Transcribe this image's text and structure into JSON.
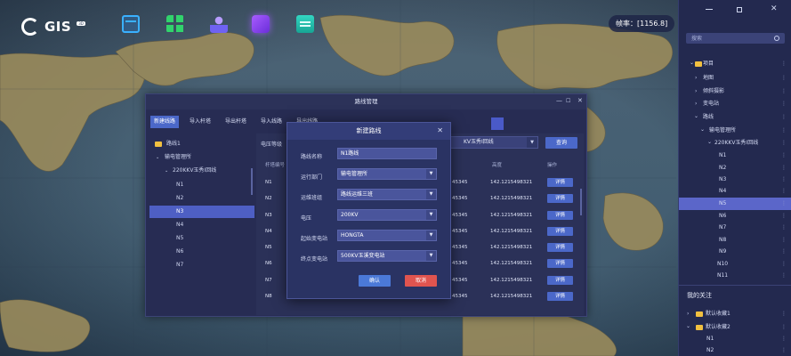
{
  "app": {
    "logo_text": "GIS",
    "logo_badge": "3D",
    "fps_label": "帧率：[1156.8]"
  },
  "toolbar": {
    "icons": [
      "layers-icon",
      "grid-apps-icon",
      "user-location-icon",
      "cube-3d-icon",
      "list-panel-icon"
    ]
  },
  "right_panel": {
    "search_placeholder": "搜索",
    "tree": [
      {
        "label": "项目"
      },
      {
        "label": "地图"
      },
      {
        "label": "倾斜摄影"
      },
      {
        "label": "变电站"
      },
      {
        "label": "路线"
      },
      {
        "label": "输电管理所"
      },
      {
        "label": "220KKV玉秀Ⅰ回线"
      },
      {
        "label": "N1"
      },
      {
        "label": "N2"
      },
      {
        "label": "N3"
      },
      {
        "label": "N4"
      },
      {
        "label": "N5"
      },
      {
        "label": "N6"
      },
      {
        "label": "N7"
      },
      {
        "label": "N8"
      },
      {
        "label": "N9"
      },
      {
        "label": "N10"
      },
      {
        "label": "N11"
      }
    ],
    "favorites_title": "我的关注",
    "favorites": [
      {
        "label": "默认收藏1"
      },
      {
        "label": "默认收藏2"
      },
      {
        "label": "N1"
      },
      {
        "label": "N2"
      }
    ]
  },
  "route_dialog": {
    "title": "路线管理",
    "tabs": [
      "新建线路",
      "导入杆塔",
      "导出杆塔",
      "导入线路",
      "导出线路"
    ],
    "left_tree": [
      {
        "label": "路线1"
      },
      {
        "label": "输电管理所"
      },
      {
        "label": "220KKV玉秀Ⅰ回线"
      },
      {
        "label": "N1"
      },
      {
        "label": "N2"
      },
      {
        "label": "N3"
      },
      {
        "label": "N4"
      },
      {
        "label": "N5"
      },
      {
        "label": "N6"
      },
      {
        "label": "N7"
      }
    ],
    "filter_label": "电压等级",
    "line_select_value": "KV玉秀Ⅰ回线",
    "query_label": "查询",
    "columns": {
      "tower_no": "杆塔编号",
      "height": "高度",
      "action": "操作"
    },
    "rows": [
      {
        "tower": "N1",
        "lng": "45345",
        "height": "142.1215498321",
        "action": "详情"
      },
      {
        "tower": "N2",
        "lng": "45345",
        "height": "142.1215498321",
        "action": "详情"
      },
      {
        "tower": "N3",
        "lng": "45345",
        "height": "142.1215498321",
        "action": "详情"
      },
      {
        "tower": "N4",
        "lng": "45345",
        "height": "142.1215498321",
        "action": "详情"
      },
      {
        "tower": "N5",
        "lng": "45345",
        "height": "142.1215498321",
        "action": "详情"
      },
      {
        "tower": "N6",
        "lng": "45345",
        "height": "142.1215498321",
        "action": "详情"
      },
      {
        "tower": "N7",
        "lng": "45345",
        "height": "142.1215498321",
        "action": "详情"
      },
      {
        "tower": "N8",
        "lng": "45345",
        "height": "142.1215498321",
        "action": "详情"
      }
    ]
  },
  "new_route_modal": {
    "title": "新建路线",
    "fields": [
      {
        "label": "路线名称",
        "value": "N1路线"
      },
      {
        "label": "运行部门",
        "value": "输电管理所"
      },
      {
        "label": "运维班组",
        "value": "路线运维三班"
      },
      {
        "label": "电压",
        "value": "200KV"
      },
      {
        "label": "起始变电站",
        "value": "HONGTA"
      },
      {
        "label": "终点变电站",
        "value": "500KV玉溪变电站"
      }
    ],
    "confirm_label": "确认",
    "cancel_label": "取消"
  },
  "colors": {
    "accent": "#4b68c9",
    "cancel": "#e0544f",
    "panel": "#23294f"
  }
}
